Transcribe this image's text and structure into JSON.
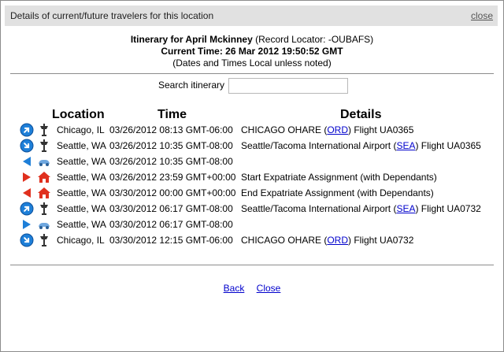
{
  "dialog": {
    "title": "Details of current/future travelers for this location",
    "close_label": "close"
  },
  "header": {
    "itinerary_prefix": "Itinerary for April Mckinney",
    "locator": " (Record Locator: -OUBAFS)",
    "current_time": "Current Time: 26 Mar 2012 19:50:52 GMT",
    "note": "(Dates and Times Local unless noted)"
  },
  "search": {
    "label": "Search itinerary",
    "value": "",
    "placeholder": ""
  },
  "columns": {
    "location": "Location",
    "time": "Time",
    "details": "Details"
  },
  "rows": [
    {
      "icon1": "blue-arrow-up-right-icon",
      "icon2": "airport-tower-icon",
      "location": "Chicago, IL",
      "time": "03/26/2012 08:13 GMT-06:00",
      "details_pre": "CHICAGO OHARE (",
      "link": "ORD",
      "details_post": ") Flight UA0365"
    },
    {
      "icon1": "blue-arrow-down-right-icon",
      "icon2": "airport-tower-icon",
      "location": "Seattle, WA",
      "time": "03/26/2012 10:35 GMT-08:00",
      "details_pre": "Seattle/Tacoma International Airport (",
      "link": "SEA",
      "details_post": ") Flight UA0365"
    },
    {
      "icon1": "blue-arrow-left-icon",
      "icon2": "car-icon",
      "location": "Seattle, WA",
      "time": "03/26/2012 10:35 GMT-08:00",
      "details_pre": "",
      "link": "",
      "details_post": ""
    },
    {
      "icon1": "red-arrow-right-icon",
      "icon2": "house-icon",
      "location": "Seattle, WA",
      "time": "03/26/2012 23:59 GMT+00:00",
      "details_pre": "Start Expatriate Assignment (with Dependants)",
      "link": "",
      "details_post": ""
    },
    {
      "icon1": "red-arrow-left-icon",
      "icon2": "house-icon",
      "location": "Seattle, WA",
      "time": "03/30/2012 00:00 GMT+00:00",
      "details_pre": "End Expatriate Assignment (with Dependants)",
      "link": "",
      "details_post": ""
    },
    {
      "icon1": "blue-arrow-up-right-icon",
      "icon2": "airport-tower-icon",
      "location": "Seattle, WA",
      "time": "03/30/2012 06:17 GMT-08:00",
      "details_pre": "Seattle/Tacoma International Airport (",
      "link": "SEA",
      "details_post": ") Flight UA0732"
    },
    {
      "icon1": "blue-arrow-right-icon",
      "icon2": "car-icon",
      "location": "Seattle, WA",
      "time": "03/30/2012 06:17 GMT-08:00",
      "details_pre": "",
      "link": "",
      "details_post": ""
    },
    {
      "icon1": "blue-arrow-down-right-icon",
      "icon2": "airport-tower-icon",
      "location": "Chicago, IL",
      "time": "03/30/2012 12:15 GMT-06:00",
      "details_pre": "CHICAGO OHARE (",
      "link": "ORD",
      "details_post": ") Flight UA0732"
    }
  ],
  "footer": {
    "back_label": "Back",
    "close_label": "Close"
  },
  "colors": {
    "blue_icon": "#1e7fd8",
    "red_icon": "#e0301e",
    "link": "#0000cc",
    "titlebar": "#e1e1e1"
  }
}
